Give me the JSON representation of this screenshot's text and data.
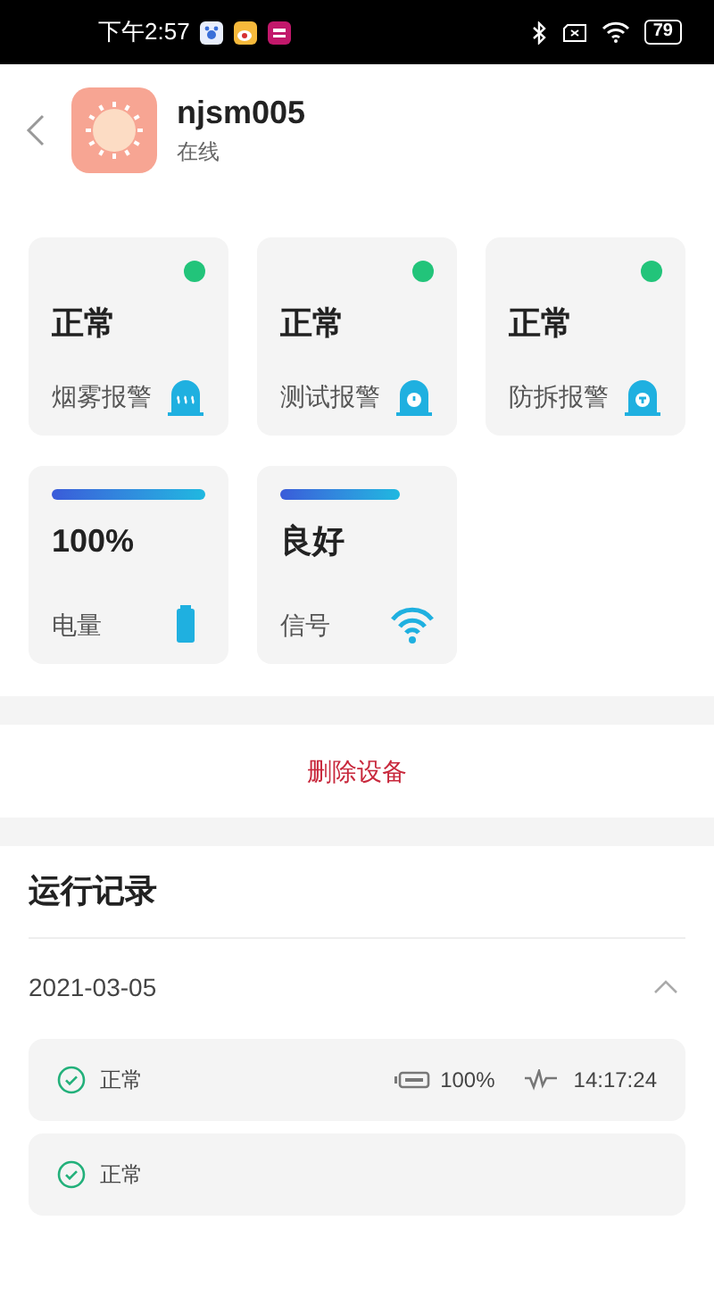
{
  "status_bar": {
    "time": "下午2:57",
    "battery": "79"
  },
  "device": {
    "name": "njsm005",
    "status": "在线"
  },
  "alarms": [
    {
      "value": "正常",
      "label": "烟雾报警",
      "kind": "smoke",
      "color": "#22c47a"
    },
    {
      "value": "正常",
      "label": "测试报警",
      "kind": "test",
      "color": "#22c47a"
    },
    {
      "value": "正常",
      "label": "防拆报警",
      "kind": "tamper",
      "color": "#22c47a"
    }
  ],
  "meters": [
    {
      "value": "100%",
      "label": "电量",
      "kind": "battery"
    },
    {
      "value": "良好",
      "label": "信号",
      "kind": "signal"
    }
  ],
  "delete_button": "删除设备",
  "log": {
    "title": "运行记录",
    "date": "2021-03-05",
    "expanded": true,
    "records": [
      {
        "status": "正常",
        "battery": "100%",
        "time": "14:17:24"
      },
      {
        "status": "正常"
      }
    ]
  }
}
